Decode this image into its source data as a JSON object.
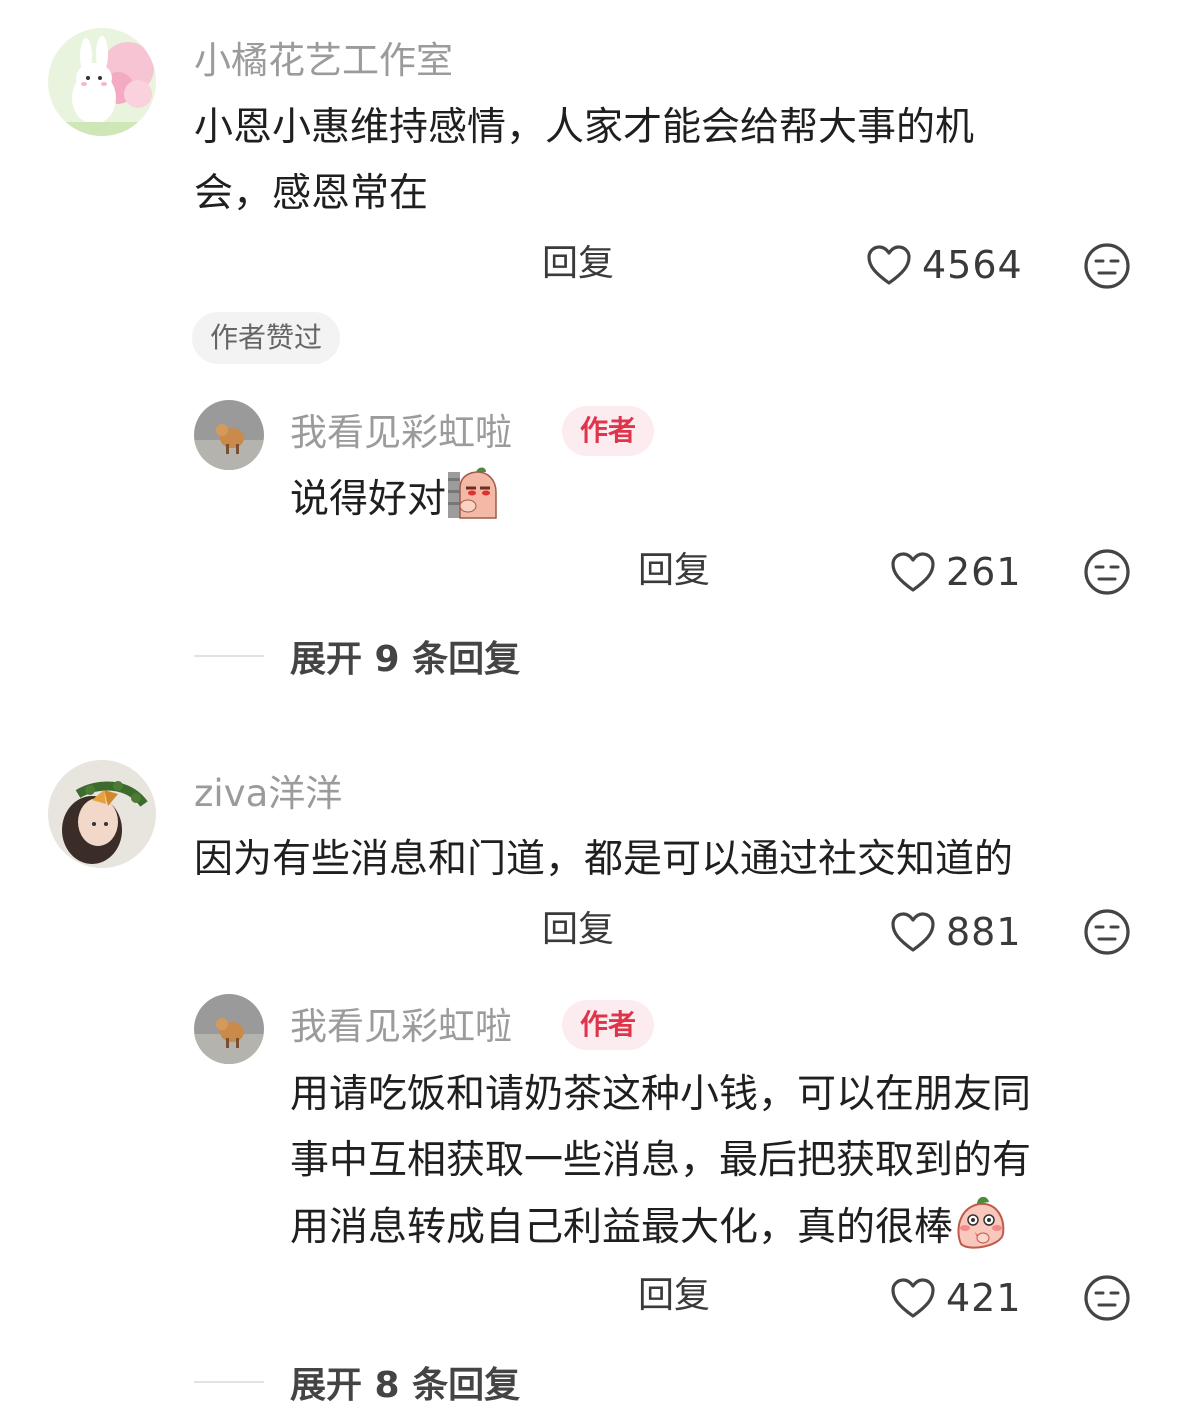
{
  "comments": [
    {
      "username": "小橘花艺工作室",
      "lines": [
        "小恩小惠维持感情，人家才能会给帮大事的机",
        "会，感恩常在"
      ],
      "reply_label": "回复",
      "likes": "4564",
      "liked_by_author_tag": "作者赞过",
      "reply": {
        "username": "我看见彩虹啦",
        "badge": "作者",
        "text": "说得好对",
        "reply_label": "回复",
        "likes": "261"
      },
      "expand_label": "展开 9 条回复"
    },
    {
      "username": "ziva洋洋",
      "lines": [
        "因为有些消息和门道，都是可以通过社交知道的"
      ],
      "reply_label": "回复",
      "likes": "881",
      "reply": {
        "username": "我看见彩虹啦",
        "badge": "作者",
        "lines": [
          "用请吃饭和请奶茶这种小钱，可以在朋友同",
          "事中互相获取一些消息，最后把获取到的有",
          "用消息转成自己利益最大化，真的很棒"
        ],
        "reply_label": "回复",
        "likes": "421"
      },
      "expand_label": "展开 8 条回复"
    }
  ],
  "icons": {
    "like": "heart-outline-icon",
    "dislike": "unamused-face-icon",
    "emoji_1": "peeking-emoji",
    "emoji_2": "blushing-emoji"
  },
  "colors": {
    "username": "#9b9b9b",
    "badge_text": "#e0334c",
    "badge_bg": "#fdecef",
    "text": "#1f1f1f"
  }
}
